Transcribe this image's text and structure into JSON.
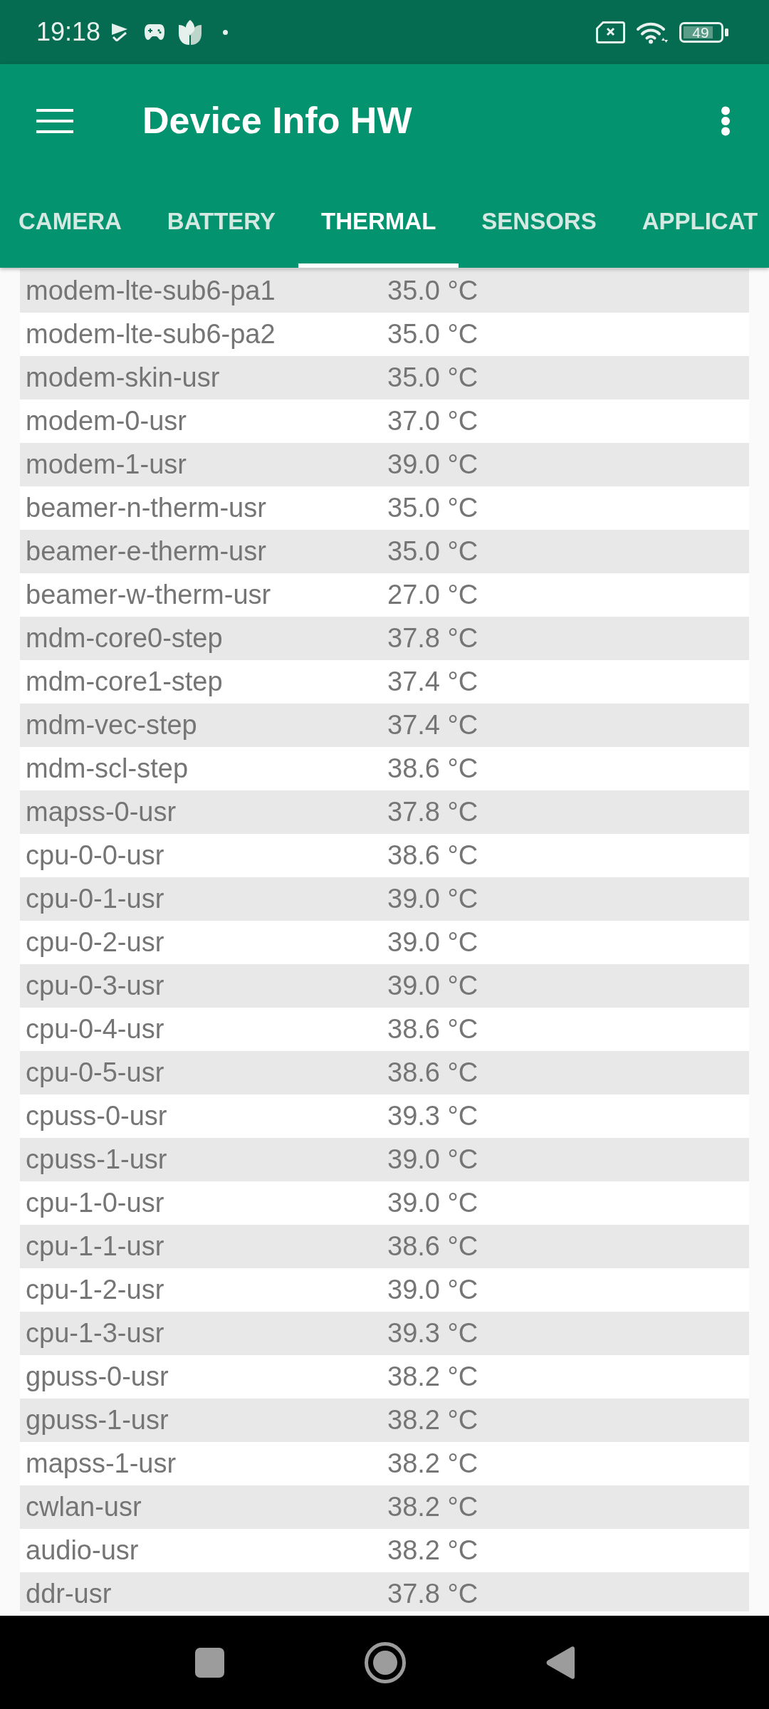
{
  "status_bar": {
    "time": "19:18",
    "battery": "49"
  },
  "app_bar": {
    "title": "Device Info HW"
  },
  "tabs": [
    {
      "label": "CAMERA",
      "selected": false
    },
    {
      "label": "BATTERY",
      "selected": false
    },
    {
      "label": "THERMAL",
      "selected": true
    },
    {
      "label": "SENSORS",
      "selected": false
    },
    {
      "label": "APPLICAT",
      "selected": false
    }
  ],
  "thermal_zones": [
    {
      "name": "modem-lte-sub6-pa1",
      "temperature": "35.0 °C"
    },
    {
      "name": "modem-lte-sub6-pa2",
      "temperature": "35.0 °C"
    },
    {
      "name": "modem-skin-usr",
      "temperature": "35.0 °C"
    },
    {
      "name": "modem-0-usr",
      "temperature": "37.0 °C"
    },
    {
      "name": "modem-1-usr",
      "temperature": "39.0 °C"
    },
    {
      "name": "beamer-n-therm-usr",
      "temperature": "35.0 °C"
    },
    {
      "name": "beamer-e-therm-usr",
      "temperature": "35.0 °C"
    },
    {
      "name": "beamer-w-therm-usr",
      "temperature": "27.0 °C"
    },
    {
      "name": "mdm-core0-step",
      "temperature": "37.8 °C"
    },
    {
      "name": "mdm-core1-step",
      "temperature": "37.4 °C"
    },
    {
      "name": "mdm-vec-step",
      "temperature": "37.4 °C"
    },
    {
      "name": "mdm-scl-step",
      "temperature": "38.6 °C"
    },
    {
      "name": "mapss-0-usr",
      "temperature": "37.8 °C"
    },
    {
      "name": "cpu-0-0-usr",
      "temperature": "38.6 °C"
    },
    {
      "name": "cpu-0-1-usr",
      "temperature": "39.0 °C"
    },
    {
      "name": "cpu-0-2-usr",
      "temperature": "39.0 °C"
    },
    {
      "name": "cpu-0-3-usr",
      "temperature": "39.0 °C"
    },
    {
      "name": "cpu-0-4-usr",
      "temperature": "38.6 °C"
    },
    {
      "name": "cpu-0-5-usr",
      "temperature": "38.6 °C"
    },
    {
      "name": "cpuss-0-usr",
      "temperature": "39.3 °C"
    },
    {
      "name": "cpuss-1-usr",
      "temperature": "39.0 °C"
    },
    {
      "name": "cpu-1-0-usr",
      "temperature": "39.0 °C"
    },
    {
      "name": "cpu-1-1-usr",
      "temperature": "38.6 °C"
    },
    {
      "name": "cpu-1-2-usr",
      "temperature": "39.0 °C"
    },
    {
      "name": "cpu-1-3-usr",
      "temperature": "39.3 °C"
    },
    {
      "name": "gpuss-0-usr",
      "temperature": "38.2 °C"
    },
    {
      "name": "gpuss-1-usr",
      "temperature": "38.2 °C"
    },
    {
      "name": "mapss-1-usr",
      "temperature": "38.2 °C"
    },
    {
      "name": "cwlan-usr",
      "temperature": "38.2 °C"
    },
    {
      "name": "audio-usr",
      "temperature": "38.2 °C"
    },
    {
      "name": "ddr-usr",
      "temperature": "37.8 °C"
    }
  ]
}
